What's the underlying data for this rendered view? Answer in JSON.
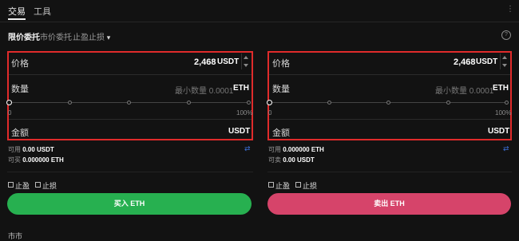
{
  "topbar": {
    "tab_trade": "交易",
    "tab_tools": "工具"
  },
  "order_tabs": {
    "limit": "限价委托",
    "market": "市价委托",
    "stop": "止盈止损",
    "stop_chevron": "▾"
  },
  "buy_panel": {
    "price_label": "价格",
    "price_value": "2,468",
    "price_unit": "USDT",
    "amount_label": "数量",
    "amount_placeholder": "最小数量 0.0001",
    "amount_unit": "ETH",
    "slider_left": "0",
    "slider_right": "100%",
    "slider_level_percent": 0,
    "total_label": "金额",
    "total_unit": "USDT",
    "avail_label": "可用",
    "avail_value": "0.00 USDT",
    "buyable_label": "可买",
    "buyable_value": "0.000000 ETH",
    "take_profit": "止盈",
    "stop_loss": "止损",
    "button": "买入 ETH"
  },
  "sell_panel": {
    "price_label": "价格",
    "price_value": "2,468",
    "price_unit": "USDT",
    "amount_label": "数量",
    "amount_placeholder": "最小数量 0.0001",
    "amount_unit": "ETH",
    "slider_left": "0",
    "slider_right": "100%",
    "slider_level_percent": 0,
    "total_label": "金额",
    "total_unit": "USDT",
    "avail_label": "可用",
    "avail_value": "0.000000 ETH",
    "sellable_label": "可卖",
    "sellable_value": "0.00 USDT",
    "take_profit": "止盈",
    "stop_loss": "止损",
    "button": "卖出 ETH"
  },
  "bottom": {
    "label": "市市"
  },
  "colors": {
    "highlight_border": "#e02b2b",
    "buy": "#27b050",
    "sell": "#d6446a",
    "swap_icon": "#3b6fd8"
  },
  "icons": {
    "help": "help-circle-icon",
    "swap": "swap-icon",
    "stepper": "stepper-icon",
    "menu": "more-icon"
  }
}
